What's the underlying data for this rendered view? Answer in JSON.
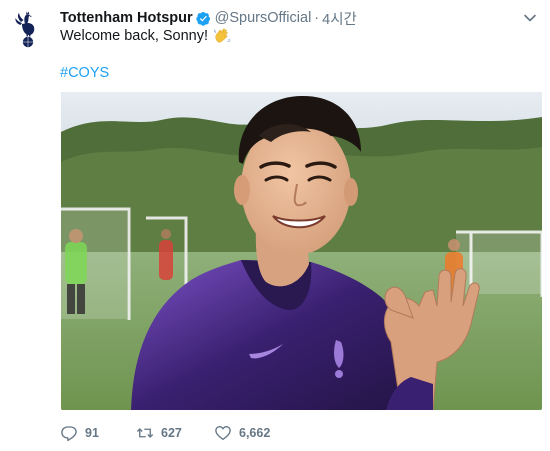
{
  "tweet": {
    "author_name": "Tottenham Hotspur",
    "handle": "@SpursOfficial",
    "separator": "·",
    "time": "4시간",
    "text": "Welcome back, Sonny!",
    "hashtag": "#COYS",
    "emoji": "waving-hand-icon"
  },
  "media": {
    "kind": "photo"
  },
  "actions": {
    "reply_count": "91",
    "retweet_count": "627",
    "like_count": "6,662"
  },
  "icons": {
    "verified": "verified-badge-icon",
    "caret": "chevron-down-icon",
    "reply": "reply-icon",
    "retweet": "retweet-icon",
    "like": "heart-icon",
    "avatar": "spurs-cockerel-logo"
  },
  "colors": {
    "link": "#1da1f2",
    "secondary_text": "#657786",
    "primary_text": "#14171a",
    "kit_purple": "#6b3fb3",
    "club_navy": "#132257"
  }
}
